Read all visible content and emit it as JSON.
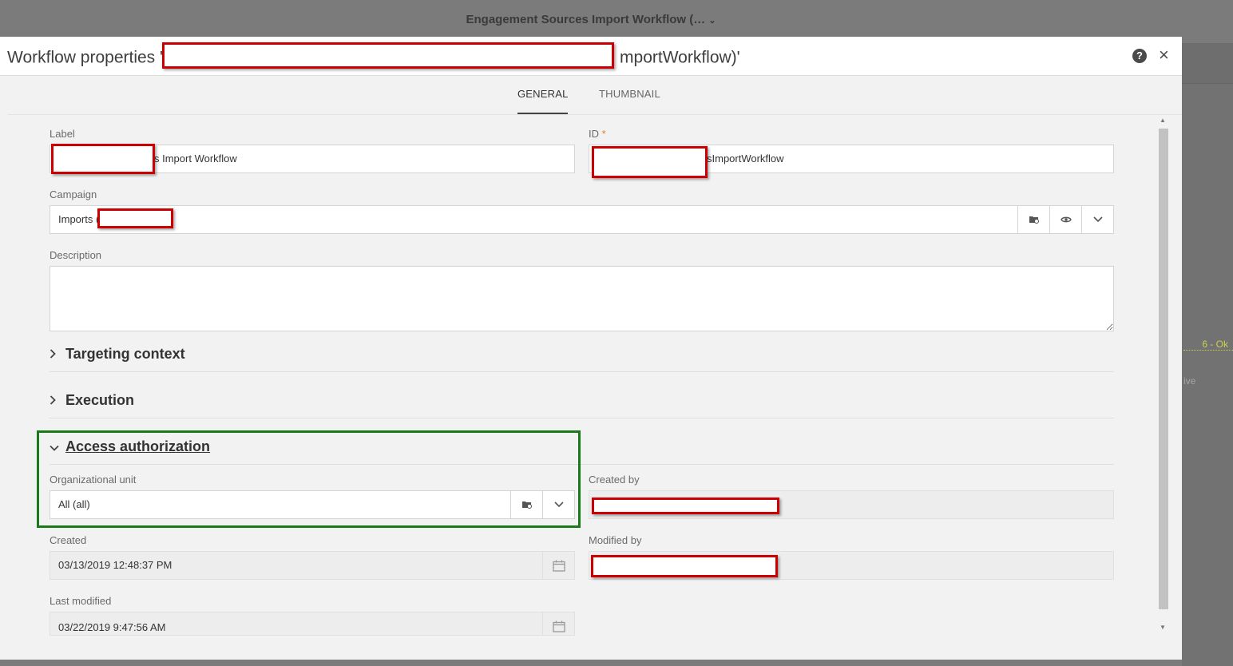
{
  "background": {
    "window_title": "Engagement Sources Import Workflow (…",
    "status_ok": "6 - Ok",
    "partial_text": "ive"
  },
  "dialog": {
    "title_prefix": "Workflow properties 'E",
    "title_suffix": "mportWorkflow)'",
    "help_symbol": "?",
    "close_symbol": "×"
  },
  "tabs": [
    {
      "label": "GENERAL",
      "active": true
    },
    {
      "label": "THUMBNAIL",
      "active": false
    }
  ],
  "form": {
    "label": {
      "label": "Label",
      "value": "s Import Workflow"
    },
    "id": {
      "label": "ID",
      "required_mark": "*",
      "value": "sImportWorkflow"
    },
    "campaign": {
      "label": "Campaign",
      "value": "Imports ("
    },
    "description": {
      "label": "Description",
      "value": ""
    },
    "sections": {
      "targeting": "Targeting context",
      "execution": "Execution",
      "access": "Access authorization"
    },
    "org_unit": {
      "label": "Organizational unit",
      "value": "All (all)"
    },
    "created_by": {
      "label": "Created by",
      "value": ""
    },
    "created": {
      "label": "Created",
      "value": "03/13/2019 12:48:37 PM"
    },
    "modified_by": {
      "label": "Modified by",
      "value": ""
    },
    "last_modified": {
      "label": "Last modified",
      "value": "03/22/2019 9:47:56 AM"
    }
  },
  "colors": {
    "redaction": "#cc0000",
    "highlight": "#1a7a1a",
    "required": "#e67e22"
  }
}
